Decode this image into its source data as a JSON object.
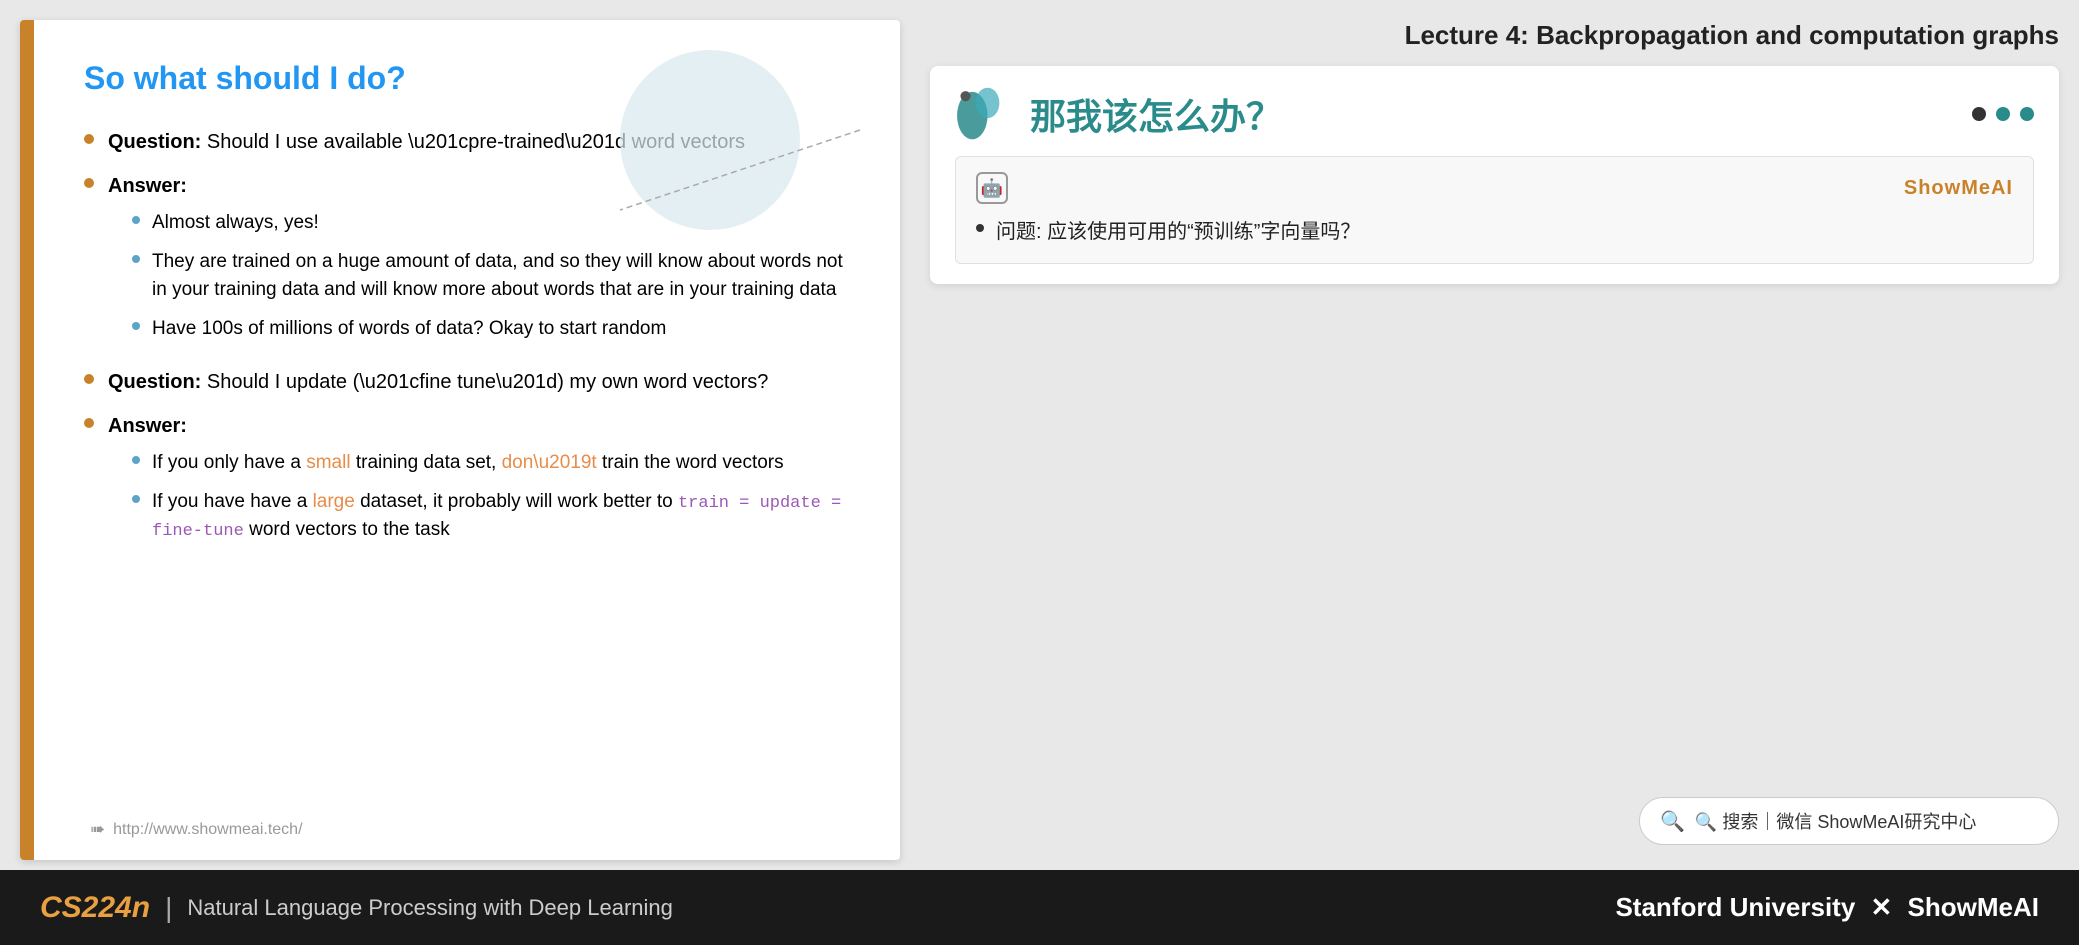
{
  "lecture_header": "Lecture 4:  Backpropagation and computation graphs",
  "slide": {
    "title": "So what should I do?",
    "bullets": [
      {
        "type": "main",
        "bold_prefix": "Question:",
        "text": " Should I use available “pre-trained” word vectors",
        "sub_items": []
      },
      {
        "type": "main",
        "bold_prefix": "Answer:",
        "text": "",
        "sub_items": [
          "Almost always, yes!",
          "They are trained on a huge amount of data, and so they will know about words not in your training data and will know more about words that are in your training data",
          "Have 100s of millions of words of data? Okay to start random"
        ]
      },
      {
        "type": "main",
        "bold_prefix": "Question:",
        "text": " Should I update (“fine tune”) my own word vectors?",
        "sub_items": []
      },
      {
        "type": "main",
        "bold_prefix": "Answer:",
        "text": "",
        "sub_items": []
      }
    ],
    "answer2_sub": [
      "small_dataset",
      "large_dataset"
    ],
    "footer_url": "http://www.showmeai.tech/"
  },
  "translation": {
    "title": "那我该怎么办？",
    "showmeai_label": "ShowMeAI",
    "robot_icon": "🤖",
    "content_bullet": "问题: 应该使用可用的“预训练”字向量吗？",
    "dots": [
      "dark",
      "teal",
      "teal"
    ]
  },
  "search_box": {
    "placeholder": "🔍 搜索｜微信 ShowMeAI研究中心",
    "text": "🔍 搜索｜微信 ShowMeAI研究中心"
  },
  "bottom_bar": {
    "cs224n": "CS224n",
    "divider": "|",
    "subtitle": "Natural Language Processing with Deep Learning",
    "right_text": "Stanford University × ShowMeAI"
  }
}
